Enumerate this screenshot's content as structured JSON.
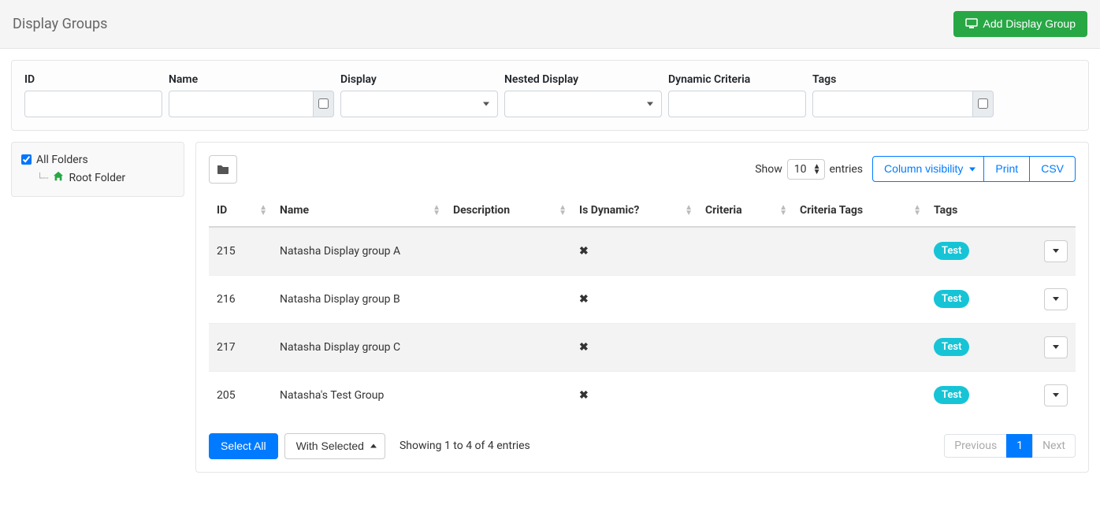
{
  "header": {
    "title": "Display Groups",
    "add_button": "Add Display Group"
  },
  "filters": {
    "id": {
      "label": "ID"
    },
    "name": {
      "label": "Name"
    },
    "display": {
      "label": "Display"
    },
    "nested_display": {
      "label": "Nested Display"
    },
    "dynamic_criteria": {
      "label": "Dynamic Criteria"
    },
    "tags": {
      "label": "Tags"
    }
  },
  "sidebar": {
    "all_folders": "All Folders",
    "root_folder": "Root Folder",
    "all_checked": true
  },
  "toolbar": {
    "show_label": "Show",
    "entries_label": "entries",
    "entries_value": "10",
    "column_visibility": "Column visibility",
    "print": "Print",
    "csv": "CSV"
  },
  "table": {
    "columns": {
      "id": "ID",
      "name": "Name",
      "description": "Description",
      "is_dynamic": "Is Dynamic?",
      "criteria": "Criteria",
      "criteria_tags": "Criteria Tags",
      "tags": "Tags"
    },
    "rows": [
      {
        "id": "215",
        "name": "Natasha Display group A",
        "description": "",
        "is_dynamic": "✖",
        "criteria": "",
        "criteria_tags": "",
        "tags": [
          "Test"
        ]
      },
      {
        "id": "216",
        "name": "Natasha Display group B",
        "description": "",
        "is_dynamic": "✖",
        "criteria": "",
        "criteria_tags": "",
        "tags": [
          "Test"
        ]
      },
      {
        "id": "217",
        "name": "Natasha Display group C",
        "description": "",
        "is_dynamic": "✖",
        "criteria": "",
        "criteria_tags": "",
        "tags": [
          "Test"
        ]
      },
      {
        "id": "205",
        "name": "Natasha's Test Group",
        "description": "",
        "is_dynamic": "✖",
        "criteria": "",
        "criteria_tags": "",
        "tags": [
          "Test"
        ]
      }
    ]
  },
  "footer": {
    "select_all": "Select All",
    "with_selected": "With Selected",
    "showing": "Showing 1 to 4 of 4 entries",
    "previous": "Previous",
    "next": "Next",
    "current_page": "1"
  }
}
